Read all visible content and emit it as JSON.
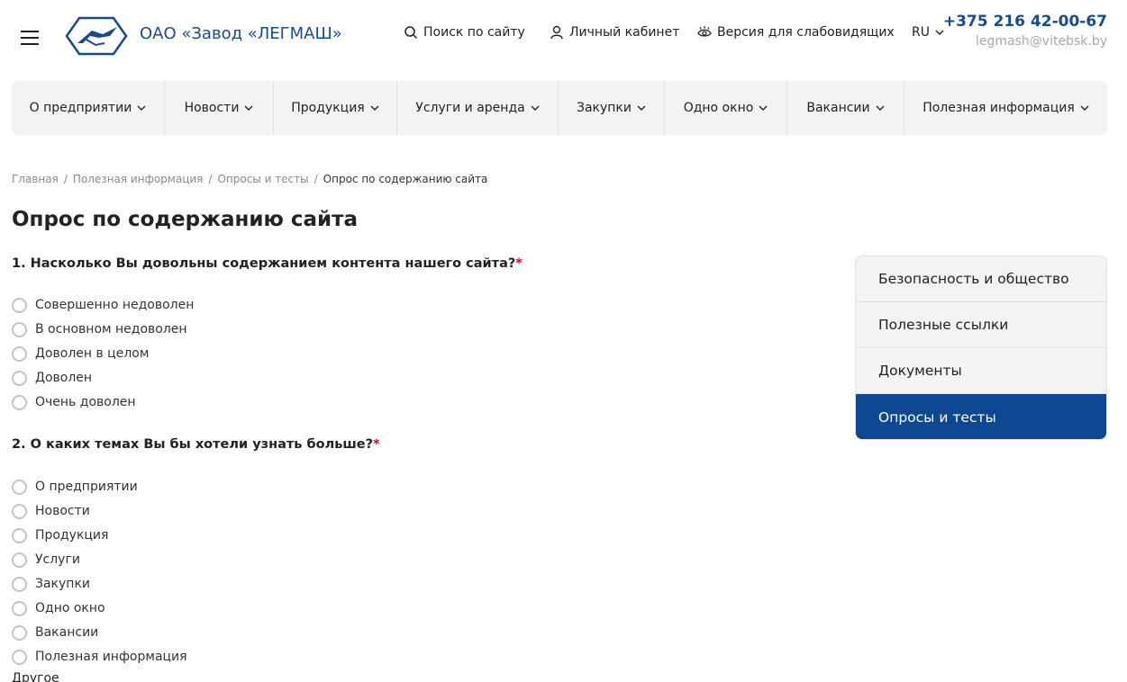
{
  "header": {
    "company_name": "ОАО «Завод «ЛЕГМАШ»",
    "search_label": "Поиск по сайту",
    "account_label": "Личный кабинет",
    "accessibility_label": "Версия для слабовидящих",
    "language": "RU",
    "phone": "+375 216 42-00-67",
    "email": "legmash@vitebsk.by"
  },
  "nav": {
    "items": [
      {
        "label": "О предприятии"
      },
      {
        "label": "Новости"
      },
      {
        "label": "Продукция"
      },
      {
        "label": "Услуги и аренда"
      },
      {
        "label": "Закупки"
      },
      {
        "label": "Одно окно"
      },
      {
        "label": "Вакансии"
      },
      {
        "label": "Полезная информация"
      }
    ]
  },
  "breadcrumb": {
    "items": [
      "Главная",
      "Полезная информация",
      "Опросы и тесты",
      "Опрос по содержанию сайта"
    ],
    "separator": "/"
  },
  "page_title": "Опрос по содержанию сайта",
  "survey": {
    "required_mark": "*",
    "q1": {
      "text": "1. Насколько Вы довольны содержанием контента нашего сайта?",
      "options": [
        "Совершенно недоволен",
        "В основном недоволен",
        "Доволен в целом",
        "Доволен",
        "Очень доволен"
      ]
    },
    "q2": {
      "text": "2. О каких темах Вы бы хотели узнать больше?",
      "options": [
        "О предприятии",
        "Новости",
        "Продукция",
        "Услуги",
        "Закупки",
        "Одно окно",
        "Вакансии",
        "Полезная информация"
      ],
      "other_label": "Другое"
    }
  },
  "side_menu": {
    "items": [
      {
        "label": "Безопасность и общество"
      },
      {
        "label": "Полезные ссылки"
      },
      {
        "label": "Документы"
      },
      {
        "label": "Опросы и тесты"
      }
    ],
    "active_index": 3
  },
  "colors": {
    "brand_blue": "#174b8f",
    "active_blue": "#0e4892",
    "required_red": "#d0021b",
    "nav_bg": "#f3f3f3"
  }
}
